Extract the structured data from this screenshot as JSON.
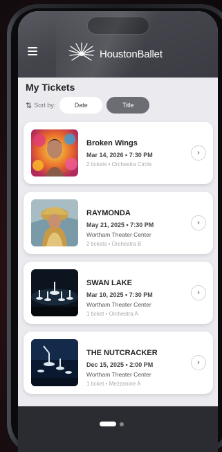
{
  "app": {
    "logo_text": "HoustonBallet"
  },
  "page": {
    "title": "My Tickets"
  },
  "sort": {
    "label": "Sort by:",
    "options": [
      "Date",
      "Title"
    ],
    "selected": "Title"
  },
  "tickets": [
    {
      "name": "Broken Wings",
      "date": "Mar 14, 2026 • 7:30 PM",
      "venue": "",
      "seats": "2 tickets • Orchestra Circle"
    },
    {
      "name": "RAYMONDA",
      "date": "May 21, 2025 • 7:30 PM",
      "venue": "Wortham Theater Center",
      "seats": "2 tickets • Orchestra B"
    },
    {
      "name": "SWAN LAKE",
      "date": "Mar 10, 2025 • 7:30 PM",
      "venue": "Wortham Theater Center",
      "seats": "1 ticket • Orchestra A"
    },
    {
      "name": "THE NUTCRACKER",
      "date": "Dec 15, 2025 • 2:00 PM",
      "venue": "Wortham Theater Center",
      "seats": "1 ticket • Mezzanine A"
    }
  ],
  "pager": {
    "pages": 2,
    "current": 1
  },
  "colors": {
    "header": "#44454c",
    "selected_segment": "#6b6c74",
    "bottom_bar": "#2b2c31"
  }
}
